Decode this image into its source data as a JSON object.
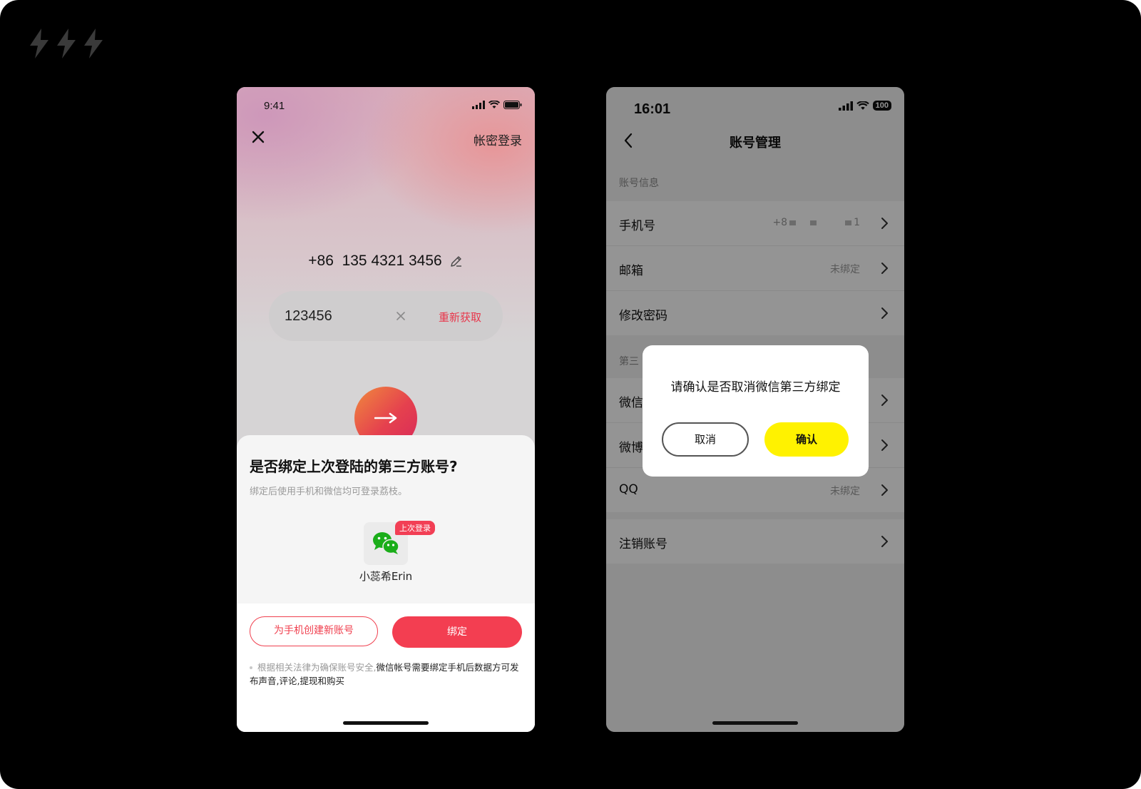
{
  "colors": {
    "brand_red": "#f33e51",
    "confirm_yellow": "#fff200",
    "wechat_green": "#1aad19",
    "background": "#000000"
  },
  "icons": [
    "bolt-icon",
    "close-icon",
    "edit-icon",
    "clear-icon",
    "arrow-right-icon",
    "wechat-icon",
    "chevron-left-icon",
    "chevron-right-icon",
    "signal-icon",
    "wifi-icon",
    "battery-icon"
  ],
  "left_phone": {
    "status_time": "9:41",
    "password_login": "帐密登录",
    "phone_number": "+86  135 4321 3456",
    "code_value": "123456",
    "resend": "重新获取",
    "sheet": {
      "title": "是否绑定上次登陆的第三方账号?",
      "subtitle": "绑定后使用手机和微信均可登录荔枝。",
      "last_login_badge": "上次登录",
      "account_name": "小蕊希Erin",
      "create_button": "为手机创建新账号",
      "bind_button": "绑定",
      "notice_gray": "根据相关法律为确保账号安全,",
      "notice_dark": "微信帐号需要绑定手机后数据方可发布声音,评论,提现和购买"
    }
  },
  "right_phone": {
    "status_time": "16:01",
    "battery": "100",
    "title": "账号管理",
    "section_account": "账号信息",
    "section_third": "第三",
    "rows_account": [
      {
        "label": "手机号",
        "value": ""
      },
      {
        "label": "邮箱",
        "value": "未绑定"
      },
      {
        "label": "修改密码",
        "value": ""
      }
    ],
    "masked_phone": {
      "prefix": "+8",
      "suffix": "1"
    },
    "rows_third": [
      {
        "label": "微信",
        "value": ""
      },
      {
        "label": "微博",
        "value": ""
      },
      {
        "label": "QQ",
        "value": "未绑定"
      }
    ],
    "row_cancel": "注销账号",
    "dialog": {
      "message": "请确认是否取消微信第三方绑定",
      "cancel": "取消",
      "confirm": "确认"
    }
  }
}
